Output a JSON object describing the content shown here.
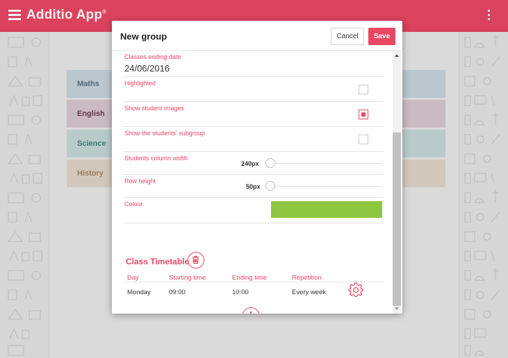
{
  "app": {
    "title": "Additio App",
    "title_mark": "®"
  },
  "background": {
    "subjects": [
      {
        "label": "Maths"
      },
      {
        "label": "English"
      },
      {
        "label": "Science"
      },
      {
        "label": "History"
      }
    ]
  },
  "dialog": {
    "title": "New group",
    "cancel_label": "Cancel",
    "save_label": "Save",
    "classes_ending_date": {
      "label": "Classes ending date",
      "value": "24/06/2016"
    },
    "highlighted": {
      "label": "Highlighted",
      "checked": false
    },
    "show_student_images": {
      "label": "Show student images",
      "checked": true
    },
    "show_subgroup": {
      "label": "Show the students' subgroup",
      "checked": false
    },
    "column_width": {
      "label": "Students column width",
      "value": "240px"
    },
    "row_height": {
      "label": "Row height",
      "value": "50px"
    },
    "colour": {
      "label": "Colour",
      "value": "#8dc63f"
    },
    "timetable": {
      "title": "Class Timetable",
      "headers": [
        "Day",
        "Starting time",
        "Ending time",
        "Repetition"
      ],
      "rows": [
        {
          "day": "Monday",
          "start": "09:00",
          "end": "10:00",
          "repetition": "Every week"
        }
      ]
    }
  },
  "colors": {
    "accent": "#e94763",
    "swatch": "#8dc63f"
  }
}
